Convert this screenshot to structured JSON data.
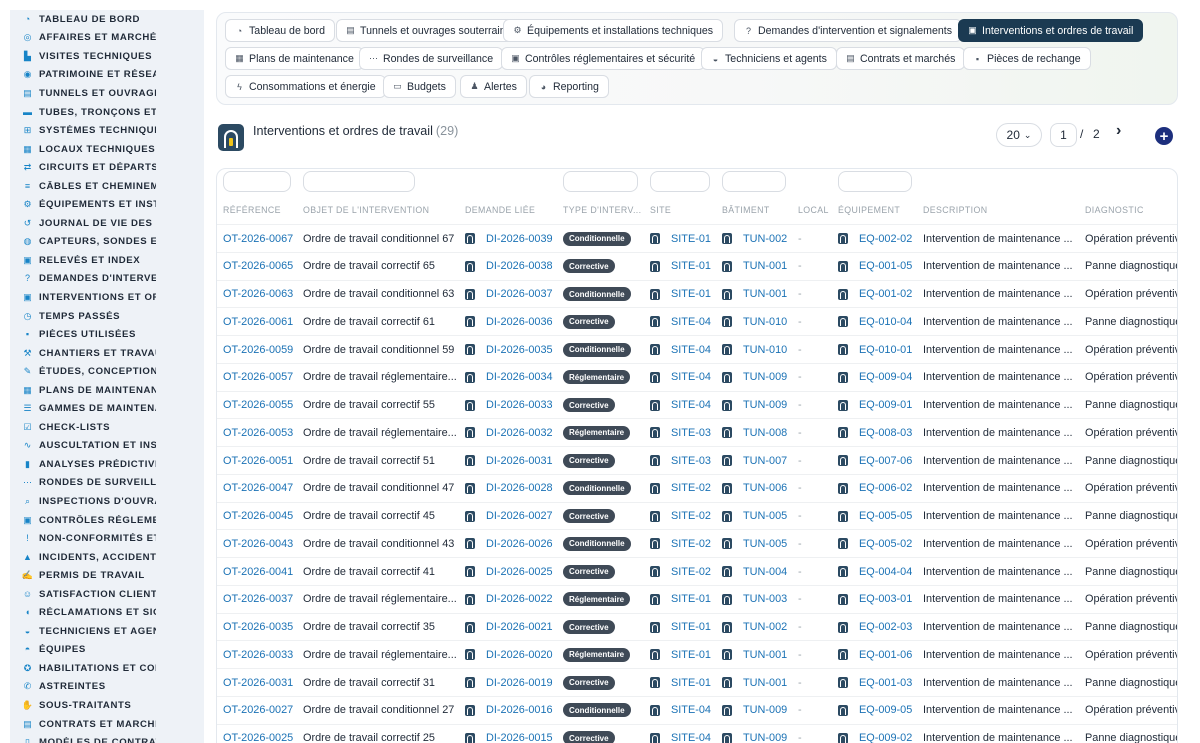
{
  "sidebar": {
    "items": [
      {
        "label": "TABLEAU DE BORD",
        "icon": "dashboard-icon",
        "glyph": "◔"
      },
      {
        "label": "AFFAIRES ET MARCHÉS",
        "icon": "target-icon",
        "glyph": "◎"
      },
      {
        "label": "VISITES TECHNIQUES ET",
        "icon": "boot-icon",
        "glyph": "▙"
      },
      {
        "label": "PATRIMOINE ET RÉSEAUX",
        "icon": "map-pin-icon",
        "glyph": "◉"
      },
      {
        "label": "TUNNELS ET OUVRAGES",
        "icon": "building-icon",
        "glyph": "▤"
      },
      {
        "label": "TUBES, TRONÇONS ET ZO",
        "icon": "ruler-icon",
        "glyph": "▬"
      },
      {
        "label": "SYSTÈMES TECHNIQUES",
        "icon": "network-icon",
        "glyph": "⊞"
      },
      {
        "label": "LOCAUX TECHNIQUES ET",
        "icon": "grid-icon",
        "glyph": "▦"
      },
      {
        "label": "CIRCUITS ET DÉPARTS ÉL",
        "icon": "flow-icon",
        "glyph": "⇄"
      },
      {
        "label": "CÂBLES ET CHEMINEMENT",
        "icon": "cable-icon",
        "glyph": "≡"
      },
      {
        "label": "ÉQUIPEMENTS ET INSTAL",
        "icon": "gears-icon",
        "glyph": "⚙"
      },
      {
        "label": "JOURNAL DE VIE DES ÉQU",
        "icon": "history-icon",
        "glyph": "↺"
      },
      {
        "label": "CAPTEURS, SONDES ET C",
        "icon": "broadcast-icon",
        "glyph": "◍"
      },
      {
        "label": "RELEVÉS ET INDEX",
        "icon": "clipboard-icon",
        "glyph": "▣"
      },
      {
        "label": "DEMANDES D'INTERVENT",
        "icon": "question-icon",
        "glyph": "?"
      },
      {
        "label": "INTERVENTIONS ET ORDR",
        "icon": "clipboard-check-icon",
        "glyph": "▣"
      },
      {
        "label": "TEMPS PASSÉS",
        "icon": "clock-icon",
        "glyph": "◷"
      },
      {
        "label": "PIÈCES UTILISÉES",
        "icon": "boxes-icon",
        "glyph": "▪"
      },
      {
        "label": "CHANTIERS ET TRAVAUX",
        "icon": "hammer-icon",
        "glyph": "⚒"
      },
      {
        "label": "ÉTUDES, CONCEPTION ET",
        "icon": "pen-icon",
        "glyph": "✎"
      },
      {
        "label": "PLANS DE MAINTENANCE",
        "icon": "calendar-icon",
        "glyph": "▦"
      },
      {
        "label": "GAMMES DE MAINTENAN",
        "icon": "list-icon",
        "glyph": "☰"
      },
      {
        "label": "CHECK-LISTS",
        "icon": "checklist-icon",
        "glyph": "☑"
      },
      {
        "label": "AUSCULTATION ET INSTR",
        "icon": "pulse-icon",
        "glyph": "∿"
      },
      {
        "label": "ANALYSES PRÉDICTIVES",
        "icon": "chart-icon",
        "glyph": "▮"
      },
      {
        "label": "RONDES DE SURVEILLAN",
        "icon": "route-icon",
        "glyph": "⋯"
      },
      {
        "label": "INSPECTIONS D'OUVRAG",
        "icon": "search-icon",
        "glyph": "⌕"
      },
      {
        "label": "CONTRÔLES RÉGLEMENT",
        "icon": "clipboard-icon",
        "glyph": "▣"
      },
      {
        "label": "NON-CONFORMITÉS ET A",
        "icon": "exclamation-icon",
        "glyph": "!"
      },
      {
        "label": "INCIDENTS, ACCIDENTS E",
        "icon": "warning-icon",
        "glyph": "▲"
      },
      {
        "label": "PERMIS DE TRAVAIL",
        "icon": "file-signature-icon",
        "glyph": "✍"
      },
      {
        "label": "SATISFACTION CLIENT",
        "icon": "smile-icon",
        "glyph": "☺"
      },
      {
        "label": "RÉCLAMATIONS ET SIGNA",
        "icon": "comment-icon",
        "glyph": "◖"
      },
      {
        "label": "TECHNICIENS ET AGENTS",
        "icon": "helmet-icon",
        "glyph": "◒"
      },
      {
        "label": "ÉQUIPES",
        "icon": "users-icon",
        "glyph": "◓"
      },
      {
        "label": "HABILITATIONS ET COMP",
        "icon": "certificate-icon",
        "glyph": "✪"
      },
      {
        "label": "ASTREINTES",
        "icon": "phone-icon",
        "glyph": "✆"
      },
      {
        "label": "SOUS-TRAITANTS",
        "icon": "handshake-icon",
        "glyph": "✋"
      },
      {
        "label": "CONTRATS ET MARCHÉS",
        "icon": "contract-icon",
        "glyph": "▤"
      },
      {
        "label": "MODÈLES DE CONTRATS",
        "icon": "file-icon",
        "glyph": "▯"
      }
    ]
  },
  "nav": {
    "tabs": [
      {
        "label": "Tableau de bord",
        "icon": "dashboard-icon",
        "glyph": "◔",
        "active": false
      },
      {
        "label": "Tunnels et ouvrages souterrains",
        "icon": "building-icon",
        "glyph": "▤",
        "active": false
      },
      {
        "label": "Équipements et installations techniques",
        "icon": "gears-icon",
        "glyph": "⚙",
        "active": false
      },
      {
        "label": "Demandes d'intervention et signalements",
        "icon": "question-icon",
        "glyph": "?",
        "active": false
      },
      {
        "label": "Interventions et ordres de travail",
        "icon": "clipboard-check-icon",
        "glyph": "▣",
        "active": true
      },
      {
        "label": "Plans de maintenance",
        "icon": "calendar-icon",
        "glyph": "▦",
        "active": false
      },
      {
        "label": "Rondes de surveillance",
        "icon": "route-icon",
        "glyph": "⋯",
        "active": false
      },
      {
        "label": "Contrôles réglementaires et sécurité",
        "icon": "clipboard-icon",
        "glyph": "▣",
        "active": false
      },
      {
        "label": "Techniciens et agents",
        "icon": "helmet-icon",
        "glyph": "◒",
        "active": false
      },
      {
        "label": "Contrats et marchés",
        "icon": "contract-icon",
        "glyph": "▤",
        "active": false
      },
      {
        "label": "Pièces de rechange",
        "icon": "boxes-icon",
        "glyph": "▪",
        "active": false
      },
      {
        "label": "Consommations et énergie",
        "icon": "bolt-icon",
        "glyph": "ϟ",
        "active": false
      },
      {
        "label": "Budgets",
        "icon": "money-icon",
        "glyph": "▭",
        "active": false
      },
      {
        "label": "Alertes",
        "icon": "bell-icon",
        "glyph": "♟",
        "active": false
      },
      {
        "label": "Reporting",
        "icon": "pie-chart-icon",
        "glyph": "◕",
        "active": false
      }
    ]
  },
  "header": {
    "title": "Interventions et ordres de travail",
    "count": "(29)",
    "page_size": "20",
    "current_page": "1",
    "separator": "/",
    "total_pages": "2",
    "next_glyph": "›",
    "add_glyph": "+"
  },
  "table": {
    "columns": [
      "RÉFÉRENCE",
      "OBJET DE L'INTERVENTION",
      "DEMANDE LIÉE",
      "TYPE D'INTERV...",
      "SITE",
      "BÂTIMENT",
      "LOCAL",
      "ÉQUIPEMENT",
      "DESCRIPTION",
      "DIAGNOSTIC"
    ],
    "rows": [
      {
        "ref": "OT-2026-0067",
        "objet": "Ordre de travail conditionnel 67",
        "demande": "DI-2026-0039",
        "type": "Conditionnelle",
        "site": "SITE-01",
        "batiment": "TUN-002",
        "local": "-",
        "equipement": "EQ-002-02",
        "description": "Intervention de maintenance ...",
        "diagnostic": "Opération préventive"
      },
      {
        "ref": "OT-2026-0065",
        "objet": "Ordre de travail correctif 65",
        "demande": "DI-2026-0038",
        "type": "Corrective",
        "site": "SITE-01",
        "batiment": "TUN-001",
        "local": "-",
        "equipement": "EQ-001-05",
        "description": "Intervention de maintenance ...",
        "diagnostic": "Panne diagnostiquée"
      },
      {
        "ref": "OT-2026-0063",
        "objet": "Ordre de travail conditionnel 63",
        "demande": "DI-2026-0037",
        "type": "Conditionnelle",
        "site": "SITE-01",
        "batiment": "TUN-001",
        "local": "-",
        "equipement": "EQ-001-02",
        "description": "Intervention de maintenance ...",
        "diagnostic": "Opération préventive"
      },
      {
        "ref": "OT-2026-0061",
        "objet": "Ordre de travail correctif 61",
        "demande": "DI-2026-0036",
        "type": "Corrective",
        "site": "SITE-04",
        "batiment": "TUN-010",
        "local": "-",
        "equipement": "EQ-010-04",
        "description": "Intervention de maintenance ...",
        "diagnostic": "Panne diagnostiquée"
      },
      {
        "ref": "OT-2026-0059",
        "objet": "Ordre de travail conditionnel 59",
        "demande": "DI-2026-0035",
        "type": "Conditionnelle",
        "site": "SITE-04",
        "batiment": "TUN-010",
        "local": "-",
        "equipement": "EQ-010-01",
        "description": "Intervention de maintenance ...",
        "diagnostic": "Opération préventive"
      },
      {
        "ref": "OT-2026-0057",
        "objet": "Ordre de travail réglementaire...",
        "demande": "DI-2026-0034",
        "type": "Réglementaire",
        "site": "SITE-04",
        "batiment": "TUN-009",
        "local": "-",
        "equipement": "EQ-009-04",
        "description": "Intervention de maintenance ...",
        "diagnostic": "Opération préventive"
      },
      {
        "ref": "OT-2026-0055",
        "objet": "Ordre de travail correctif 55",
        "demande": "DI-2026-0033",
        "type": "Corrective",
        "site": "SITE-04",
        "batiment": "TUN-009",
        "local": "-",
        "equipement": "EQ-009-01",
        "description": "Intervention de maintenance ...",
        "diagnostic": "Panne diagnostiquée"
      },
      {
        "ref": "OT-2026-0053",
        "objet": "Ordre de travail réglementaire...",
        "demande": "DI-2026-0032",
        "type": "Réglementaire",
        "site": "SITE-03",
        "batiment": "TUN-008",
        "local": "-",
        "equipement": "EQ-008-03",
        "description": "Intervention de maintenance ...",
        "diagnostic": "Opération préventive"
      },
      {
        "ref": "OT-2026-0051",
        "objet": "Ordre de travail correctif 51",
        "demande": "DI-2026-0031",
        "type": "Corrective",
        "site": "SITE-03",
        "batiment": "TUN-007",
        "local": "-",
        "equipement": "EQ-007-06",
        "description": "Intervention de maintenance ...",
        "diagnostic": "Panne diagnostiquée"
      },
      {
        "ref": "OT-2026-0047",
        "objet": "Ordre de travail conditionnel 47",
        "demande": "DI-2026-0028",
        "type": "Conditionnelle",
        "site": "SITE-02",
        "batiment": "TUN-006",
        "local": "-",
        "equipement": "EQ-006-02",
        "description": "Intervention de maintenance ...",
        "diagnostic": "Opération préventive"
      },
      {
        "ref": "OT-2026-0045",
        "objet": "Ordre de travail correctif 45",
        "demande": "DI-2026-0027",
        "type": "Corrective",
        "site": "SITE-02",
        "batiment": "TUN-005",
        "local": "-",
        "equipement": "EQ-005-05",
        "description": "Intervention de maintenance ...",
        "diagnostic": "Panne diagnostiquée"
      },
      {
        "ref": "OT-2026-0043",
        "objet": "Ordre de travail conditionnel 43",
        "demande": "DI-2026-0026",
        "type": "Conditionnelle",
        "site": "SITE-02",
        "batiment": "TUN-005",
        "local": "-",
        "equipement": "EQ-005-02",
        "description": "Intervention de maintenance ...",
        "diagnostic": "Opération préventive"
      },
      {
        "ref": "OT-2026-0041",
        "objet": "Ordre de travail correctif 41",
        "demande": "DI-2026-0025",
        "type": "Corrective",
        "site": "SITE-02",
        "batiment": "TUN-004",
        "local": "-",
        "equipement": "EQ-004-04",
        "description": "Intervention de maintenance ...",
        "diagnostic": "Panne diagnostiquée"
      },
      {
        "ref": "OT-2026-0037",
        "objet": "Ordre de travail réglementaire...",
        "demande": "DI-2026-0022",
        "type": "Réglementaire",
        "site": "SITE-01",
        "batiment": "TUN-003",
        "local": "-",
        "equipement": "EQ-003-01",
        "description": "Intervention de maintenance ...",
        "diagnostic": "Opération préventive"
      },
      {
        "ref": "OT-2026-0035",
        "objet": "Ordre de travail correctif 35",
        "demande": "DI-2026-0021",
        "type": "Corrective",
        "site": "SITE-01",
        "batiment": "TUN-002",
        "local": "-",
        "equipement": "EQ-002-03",
        "description": "Intervention de maintenance ...",
        "diagnostic": "Panne diagnostiquée"
      },
      {
        "ref": "OT-2026-0033",
        "objet": "Ordre de travail réglementaire...",
        "demande": "DI-2026-0020",
        "type": "Réglementaire",
        "site": "SITE-01",
        "batiment": "TUN-001",
        "local": "-",
        "equipement": "EQ-001-06",
        "description": "Intervention de maintenance ...",
        "diagnostic": "Opération préventive"
      },
      {
        "ref": "OT-2026-0031",
        "objet": "Ordre de travail correctif 31",
        "demande": "DI-2026-0019",
        "type": "Corrective",
        "site": "SITE-01",
        "batiment": "TUN-001",
        "local": "-",
        "equipement": "EQ-001-03",
        "description": "Intervention de maintenance ...",
        "diagnostic": "Panne diagnostiquée"
      },
      {
        "ref": "OT-2026-0027",
        "objet": "Ordre de travail conditionnel 27",
        "demande": "DI-2026-0016",
        "type": "Conditionnelle",
        "site": "SITE-04",
        "batiment": "TUN-009",
        "local": "-",
        "equipement": "EQ-009-05",
        "description": "Intervention de maintenance ...",
        "diagnostic": "Opération préventive"
      },
      {
        "ref": "OT-2026-0025",
        "objet": "Ordre de travail correctif 25",
        "demande": "DI-2026-0015",
        "type": "Corrective",
        "site": "SITE-04",
        "batiment": "TUN-009",
        "local": "-",
        "equipement": "EQ-009-02",
        "description": "Intervention de maintenance ...",
        "diagnostic": "Panne diagnostiquée"
      }
    ]
  },
  "colors": {
    "link": "#1b72b5",
    "badge": "#3f4a57",
    "active_tab": "#1b3a52",
    "add_button": "#1d2f7d",
    "sidebar_icon": "#1784c7"
  }
}
